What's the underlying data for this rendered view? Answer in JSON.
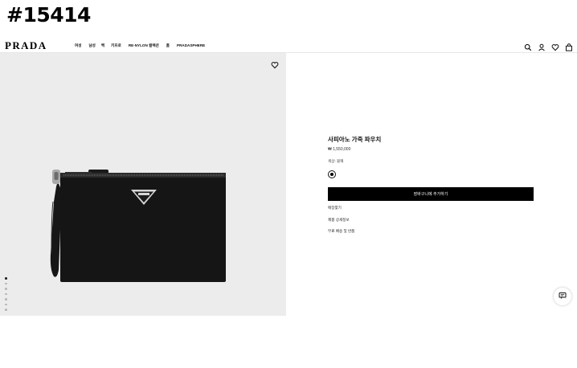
{
  "stamp": "#15414",
  "header": {
    "logo": "PRADA",
    "nav": [
      "여성",
      "남성",
      "백",
      "키프로",
      "RE-NYLON 컬렉션",
      "홈",
      "PRADASPHERE"
    ],
    "icons": [
      "search-icon",
      "user-icon",
      "heart-icon",
      "bag-icon"
    ]
  },
  "gallery": {
    "image_count": 7,
    "active_index": 0,
    "wishlist_icon": "heart-outline-icon"
  },
  "product": {
    "title": "사피아노 가죽 파우치",
    "price": "₩ 1,550,000",
    "color_label": "색상: 블랙",
    "color_swatch": "#000000",
    "add_to_cart": "장바구니에 추가하기",
    "links": [
      "매장찾기",
      "제품 상세정보",
      "무료 배송 및 반품"
    ]
  },
  "chat_icon": "chat-icon"
}
